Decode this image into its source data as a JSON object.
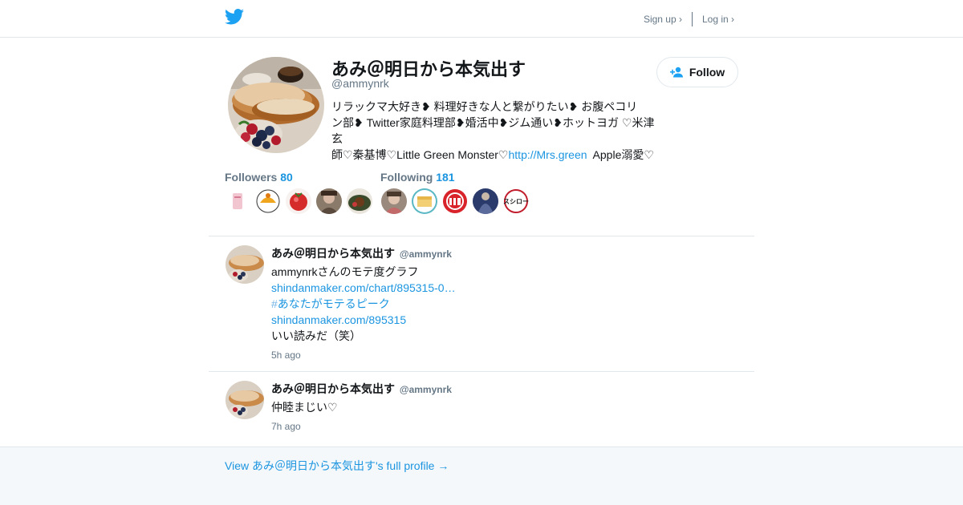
{
  "header": {
    "signup_label": "Sign up ›",
    "login_label": "Log in ›"
  },
  "profile": {
    "name": "あみ＠明日から本気出す",
    "handle": "@ammynrk",
    "bio_line1": "リラックマ大好き❥ 料理好きな人と繋がりたい❥ お腹ペコリ",
    "bio_line2": "ン部❥ Twitter家庭料理部❥婚活中❥ジム通い❥ホットヨガ ♡米津玄",
    "bio_line3_prefix": "師♡秦基博♡Little Green Monster♡",
    "bio_link": "http://Mrs.green",
    "bio_line3_suffix": "  Apple溺愛♡",
    "follow_label": "Follow"
  },
  "stats": {
    "followers_label": "Followers",
    "followers_count": "80",
    "following_label": "Following",
    "following_count": "181"
  },
  "tweets": [
    {
      "name": "あみ＠明日から本気出す",
      "handle": "@ammynrk",
      "text1": "ammynrkさんのモテ度グラフ",
      "link1": "shindanmaker.com/chart/895315-0…",
      "hashmark": "#",
      "hashtag": "あなたがモテるピーク",
      "link2": "shindanmaker.com/895315",
      "text2": "いい読みだ（笑）",
      "time": "5h ago"
    },
    {
      "name": "あみ＠明日から本気出す",
      "handle": "@ammynrk",
      "text1": "仲睦まじい♡",
      "time": "7h ago"
    }
  ],
  "footer": {
    "link_label": "View あみ＠明日から本気出す's full profile →"
  },
  "colors": {
    "accent": "#1b95e0",
    "bird": "#1da1f2",
    "muted": "#657786",
    "footer_bg": "#f5f8fa"
  }
}
